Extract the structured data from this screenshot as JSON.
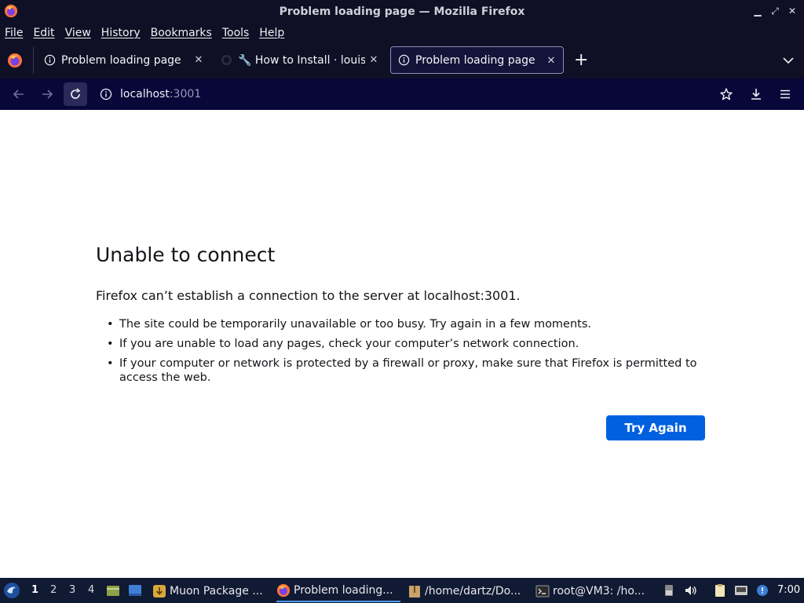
{
  "window": {
    "title": "Problem loading page — Mozilla Firefox"
  },
  "menubar": {
    "items": [
      "File",
      "Edit",
      "View",
      "History",
      "Bookmarks",
      "Tools",
      "Help"
    ]
  },
  "tabs": [
    {
      "label": "Problem loading page",
      "icon": "info-icon",
      "active": false
    },
    {
      "label": "🔧 How to Install · louisla",
      "icon": "github-icon",
      "active": false
    },
    {
      "label": "Problem loading page",
      "icon": "info-icon",
      "active": true
    }
  ],
  "navbar": {
    "url_host": "localhost",
    "url_port": ":3001"
  },
  "error_page": {
    "title": "Unable to connect",
    "description": "Firefox can’t establish a connection to the server at localhost:3001.",
    "bullets": [
      "The site could be temporarily unavailable or too busy. Try again in a few moments.",
      "If you are unable to load any pages, check your computer’s network connection.",
      "If your computer or network is protected by a firewall or proxy, make sure that Firefox is permitted to access the web."
    ],
    "button_label": "Try Again"
  },
  "taskbar": {
    "workspaces": [
      "1",
      "2",
      "3",
      "4"
    ],
    "active_workspace": "1",
    "tasks": [
      {
        "label": "Muon Package ...",
        "icon": "package-icon"
      },
      {
        "label": "Problem loading...",
        "icon": "firefox-icon",
        "active": true
      },
      {
        "label": "/home/dartz/Do...",
        "icon": "archive-icon"
      },
      {
        "label": "root@VM3: /ho...",
        "icon": "terminal-icon"
      }
    ],
    "clock": "7:00"
  },
  "colors": {
    "chrome_bg": "#0f0f26",
    "navbar_bg": "#07073a",
    "accent_button": "#0061e0",
    "taskbar_bg": "#101a33"
  }
}
